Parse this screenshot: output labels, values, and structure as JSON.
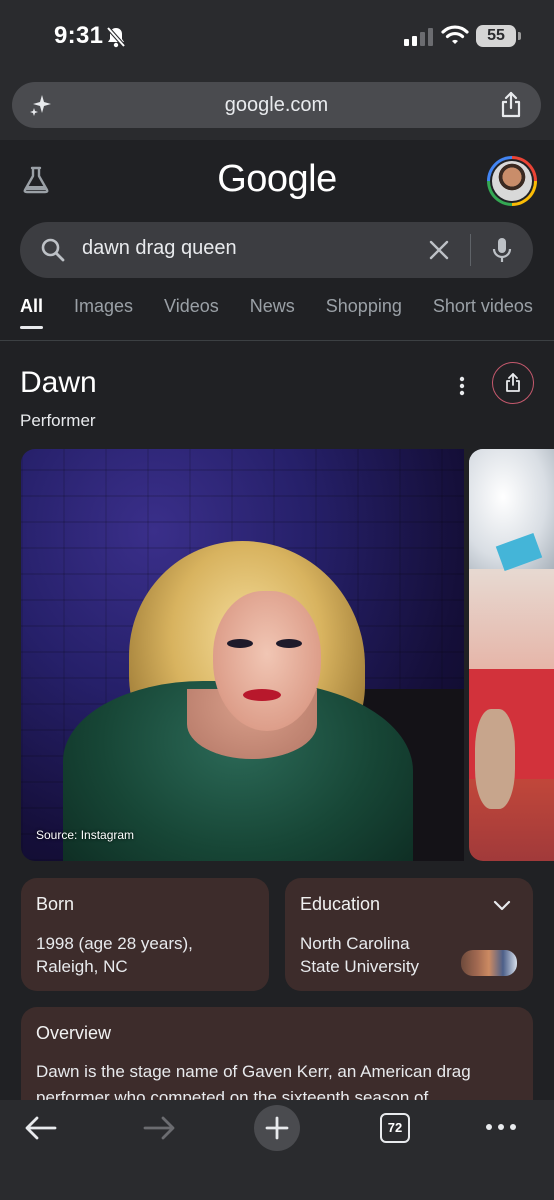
{
  "status_bar": {
    "time": "9:31",
    "battery": "55"
  },
  "browser": {
    "url": "google.com",
    "open_tabs_count": "72"
  },
  "google": {
    "logo_text": "Google",
    "search_query": "dawn drag queen"
  },
  "tabs": [
    {
      "label": "All",
      "active": true
    },
    {
      "label": "Images",
      "active": false
    },
    {
      "label": "Videos",
      "active": false
    },
    {
      "label": "News",
      "active": false
    },
    {
      "label": "Shopping",
      "active": false
    },
    {
      "label": "Short videos",
      "active": false
    }
  ],
  "knowledge_panel": {
    "title": "Dawn",
    "subtitle": "Performer",
    "image_source": "Source: Instagram",
    "born": {
      "label": "Born",
      "line1": "1998 (age 28 years),",
      "line2": "Raleigh, NC"
    },
    "education": {
      "label": "Education",
      "line1": "North Carolina",
      "line2": "State University"
    },
    "overview": {
      "label": "Overview",
      "text": "Dawn is the stage name of Gaven Kerr, an American drag performer who competed on the sixteenth season of"
    }
  },
  "colors": {
    "background": "#202124",
    "card": "#3d2c2b",
    "share_ring": "#c5596d"
  },
  "icons": [
    "bell-off-icon",
    "signal-icon",
    "wifi-icon",
    "sparkle-icon",
    "share-icon",
    "flask-icon",
    "search-icon",
    "clear-icon",
    "mic-icon",
    "more-vert-icon",
    "chevron-down-icon",
    "back-arrow-icon",
    "forward-arrow-icon",
    "plus-icon",
    "tab-switcher-icon",
    "more-horiz-icon"
  ]
}
